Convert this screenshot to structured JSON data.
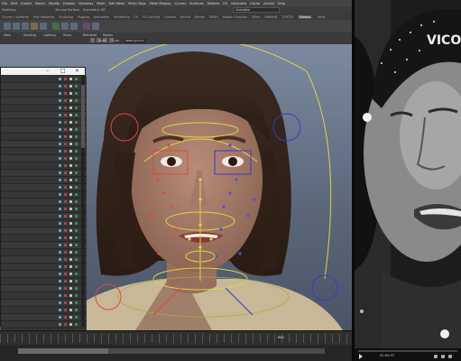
{
  "maya": {
    "menus": [
      "File",
      "Edit",
      "Create",
      "Select",
      "Modify",
      "Display",
      "Windows",
      "Mesh",
      "Edit Mesh",
      "Mesh Tools",
      "Mesh Display",
      "Curves",
      "Surfaces",
      "Deform",
      "UV",
      "Generate",
      "Cache",
      "Arnold",
      "Help"
    ],
    "status_items": [
      "Modeling",
      "No Live Surface",
      "Symmetry: Off"
    ],
    "workspace": "Charlotte",
    "shelf_tabs": [
      "Curves / Surfaces",
      "Poly Modeling",
      "Sculpting",
      "Rigging",
      "Animation",
      "Rendering",
      "FX",
      "FX Caching",
      "Custom",
      "Arnold",
      "Bifrost",
      "MASH",
      "Motion Graphics",
      "XGen",
      "Redshift",
      "TURTLE",
      "Rokoko",
      "Turtle"
    ],
    "active_shelf_tab": "Rokoko",
    "viewport_menus": [
      "View",
      "Shading",
      "Lighting",
      "Show",
      "Renderer",
      "Panels"
    ],
    "camera_value": "0.00",
    "camera_value2": "1.00",
    "camera_name": "sRGB gamma",
    "current_frame": "840"
  },
  "outliner": {
    "title_minimize": "–",
    "title_maximize": "□",
    "title_close": "×",
    "row_count": 37
  },
  "reference_video": {
    "brand_text": "VICO",
    "timecode": "00:00:37"
  },
  "colors": {
    "viewport_top": "#7b8aa0",
    "shelf_active": "#555555",
    "control_yellow": "#e2d14a",
    "control_red": "#e0483c",
    "control_blue": "#3a3acc"
  }
}
